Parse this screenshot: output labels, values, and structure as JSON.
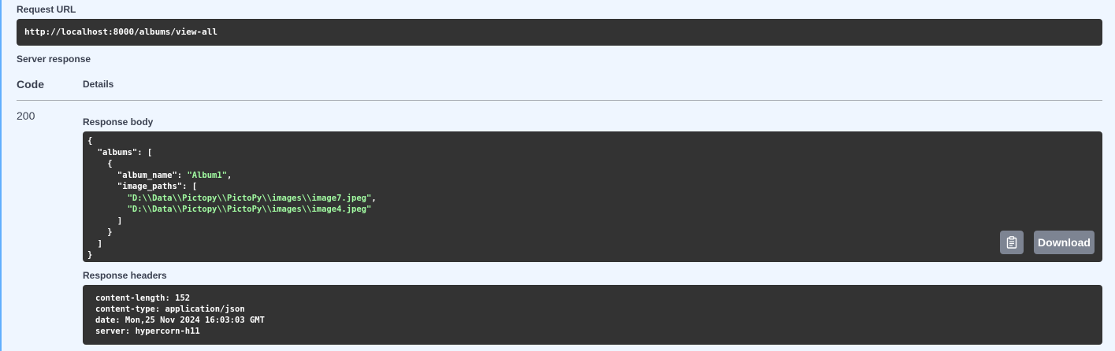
{
  "request_url": {
    "label": "Request URL",
    "value": "http://localhost:8000/albums/view-all"
  },
  "server_response": {
    "label": "Server response",
    "code_header": "Code",
    "details_header": "Details",
    "status_code": "200"
  },
  "response_body": {
    "label": "Response body",
    "lines": [
      [
        {
          "t": "{",
          "c": "punc"
        }
      ],
      [
        {
          "t": "  \"albums\"",
          "c": "key"
        },
        {
          "t": ": [",
          "c": "punc"
        }
      ],
      [
        {
          "t": "    {",
          "c": "punc"
        }
      ],
      [
        {
          "t": "      \"album_name\"",
          "c": "key"
        },
        {
          "t": ": ",
          "c": "punc"
        },
        {
          "t": "\"Album1\"",
          "c": "str"
        },
        {
          "t": ",",
          "c": "punc"
        }
      ],
      [
        {
          "t": "      \"image_paths\"",
          "c": "key"
        },
        {
          "t": ": [",
          "c": "punc"
        }
      ],
      [
        {
          "t": "        \"D:\\\\Data\\\\Pictopy\\\\PictoPy\\\\images\\\\image7.jpeg\"",
          "c": "str"
        },
        {
          "t": ",",
          "c": "punc"
        }
      ],
      [
        {
          "t": "        \"D:\\\\Data\\\\Pictopy\\\\PictoPy\\\\images\\\\image4.jpeg\"",
          "c": "str"
        }
      ],
      [
        {
          "t": "      ]",
          "c": "punc"
        }
      ],
      [
        {
          "t": "    }",
          "c": "punc"
        }
      ],
      [
        {
          "t": "  ]",
          "c": "punc"
        }
      ],
      [
        {
          "t": "}",
          "c": "punc"
        }
      ]
    ],
    "download_label": "Download",
    "copy_icon": "clipboard-icon"
  },
  "response_headers": {
    "label": "Response headers",
    "lines": [
      "content-length: 152",
      "content-type: application/json",
      "date: Mon,25 Nov 2024 16:03:03 GMT",
      "server: hypercorn-h11"
    ]
  },
  "colors": {
    "background": "#eff6ff",
    "accent": "#61affe",
    "code_bg": "#333333",
    "string": "#a2fca2",
    "button": "#7d8492"
  }
}
